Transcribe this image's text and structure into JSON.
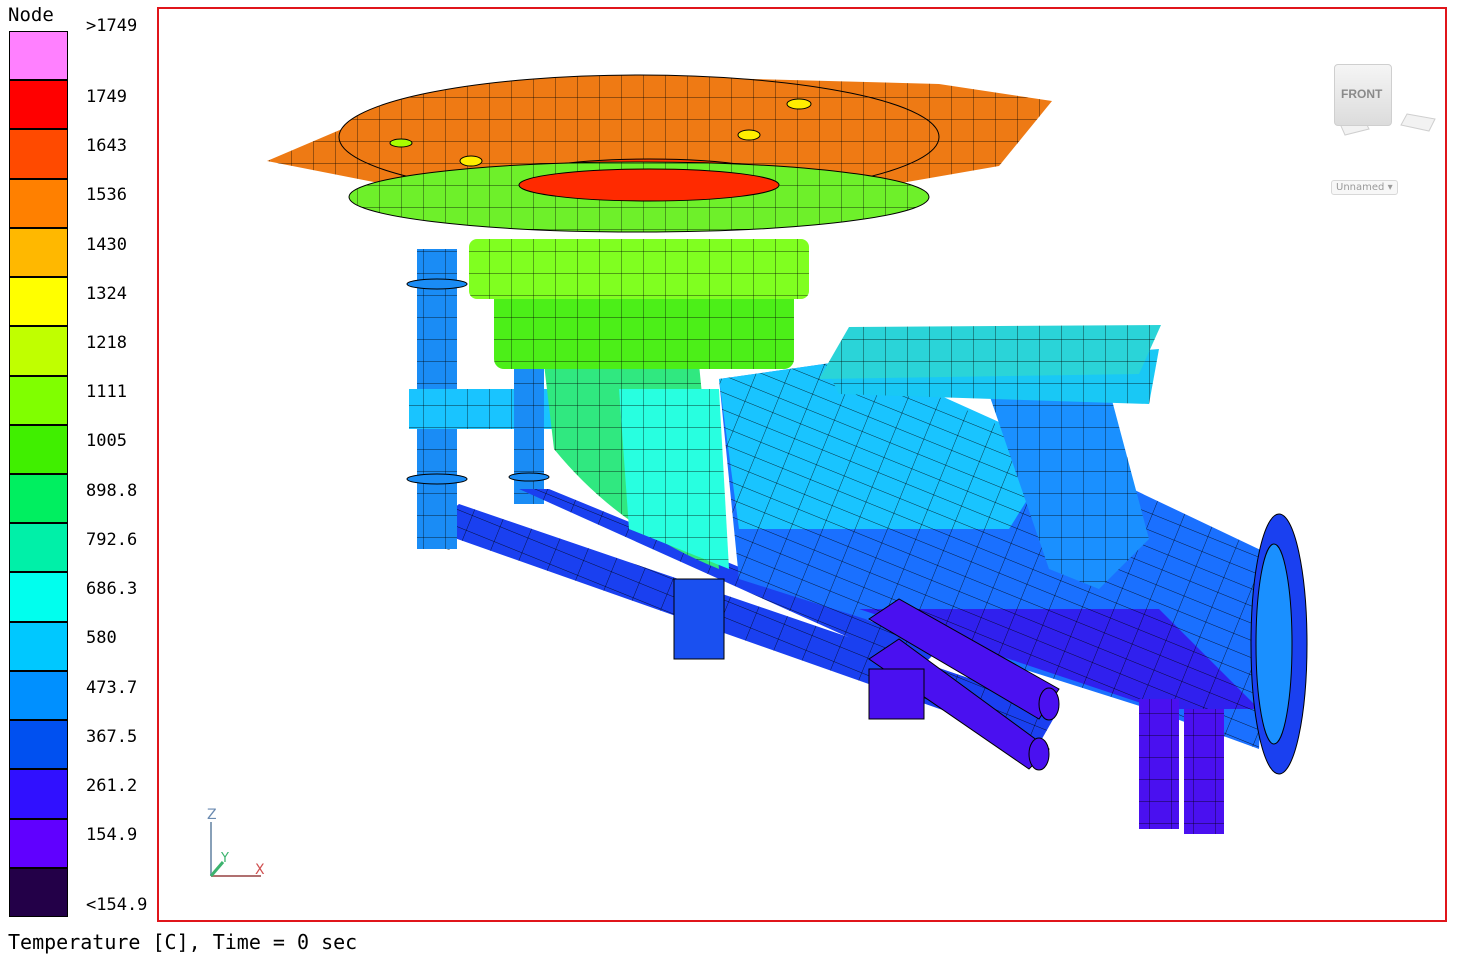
{
  "legend": {
    "title": "Node",
    "bands": [
      {
        "label": ">1749",
        "color": "#ff80ff"
      },
      {
        "label": "1749",
        "color": "#ff0000"
      },
      {
        "label": "1643",
        "color": "#ff4a00"
      },
      {
        "label": "1536",
        "color": "#ff8000"
      },
      {
        "label": "1430",
        "color": "#ffb800"
      },
      {
        "label": "1324",
        "color": "#ffff00"
      },
      {
        "label": "1218",
        "color": "#c0ff00"
      },
      {
        "label": "1111",
        "color": "#80ff00"
      },
      {
        "label": "1005",
        "color": "#40ef00"
      },
      {
        "label": "898.8",
        "color": "#00ef60"
      },
      {
        "label": "792.6",
        "color": "#00f0a8"
      },
      {
        "label": "686.3",
        "color": "#00ffee"
      },
      {
        "label": "580",
        "color": "#00c8ff"
      },
      {
        "label": "473.7",
        "color": "#0090ff"
      },
      {
        "label": "367.5",
        "color": "#0050f0"
      },
      {
        "label": "261.2",
        "color": "#3010ff"
      },
      {
        "label": "154.9",
        "color": "#6000ff"
      },
      {
        "label": "<154.9",
        "color": "#230048"
      }
    ]
  },
  "viewport": {
    "border_color": "#e0151b",
    "view_cube_label": "FRONT",
    "view_name": "Unnamed",
    "triad": {
      "x": "X",
      "y": "Y",
      "z": "Z"
    }
  },
  "caption": "Temperature [C], Time = 0 sec"
}
